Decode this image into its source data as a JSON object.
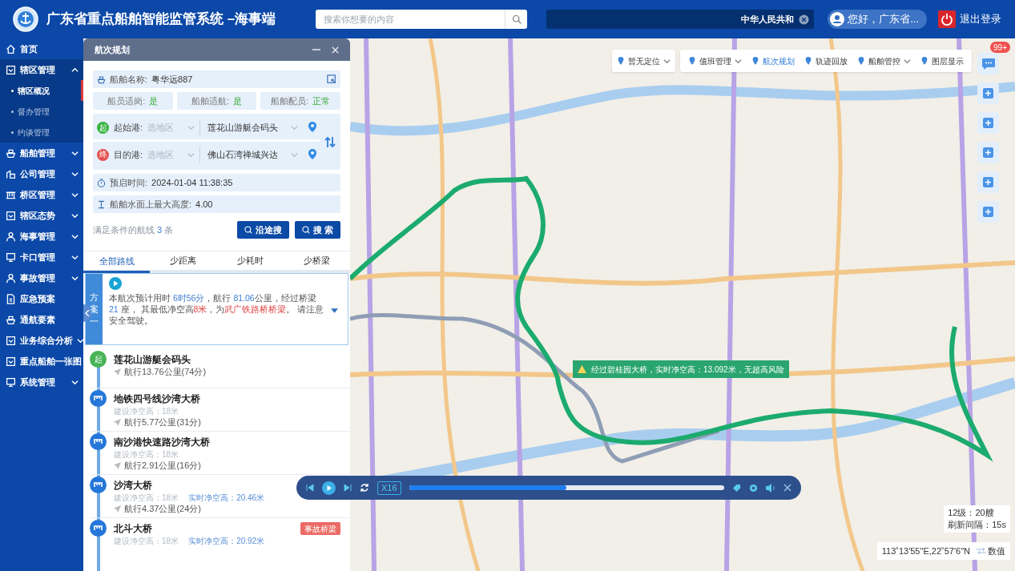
{
  "header": {
    "title": "广东省重点船舶智能监管系统 –海事端",
    "search": {
      "placeholder": "搜索你想要的内容"
    },
    "marquee": "中华人民共和",
    "user": "您好，广东省...",
    "logout": "退出登录"
  },
  "sidebar": {
    "items": [
      {
        "label": "首页",
        "kind": "link"
      },
      {
        "label": "辖区管理",
        "kind": "group",
        "expanded": true,
        "children": [
          {
            "label": "辖区概况",
            "selected": true
          },
          {
            "label": "督办管理",
            "selected": false
          },
          {
            "label": "约谈管理",
            "selected": false
          }
        ]
      },
      {
        "label": "船舶管理",
        "kind": "group",
        "expanded": false
      },
      {
        "label": "公司管理",
        "kind": "group",
        "expanded": false
      },
      {
        "label": "桥区管理",
        "kind": "group",
        "expanded": false
      },
      {
        "label": "辖区态势",
        "kind": "group",
        "expanded": false
      },
      {
        "label": "海事管理",
        "kind": "group",
        "expanded": false
      },
      {
        "label": "卡口管理",
        "kind": "group",
        "expanded": false
      },
      {
        "label": "事故管理",
        "kind": "group",
        "expanded": false
      },
      {
        "label": "应急预案",
        "kind": "link"
      },
      {
        "label": "通航要素",
        "kind": "link"
      },
      {
        "label": "业务综合分析",
        "kind": "group",
        "expanded": false
      },
      {
        "label": "重点船舶一张图",
        "kind": "link"
      },
      {
        "label": "系统管理",
        "kind": "group",
        "expanded": false
      }
    ]
  },
  "panel": {
    "title": "航次规划",
    "ship_name": {
      "label": "船舶名称:",
      "value": "粤华远887"
    },
    "status": [
      {
        "label": "船员适岗:",
        "value": "是"
      },
      {
        "label": "船舶适航:",
        "value": "是"
      },
      {
        "label": "船舶配员:",
        "value": "正常"
      }
    ],
    "ports": [
      {
        "kind": "start",
        "marker": "起",
        "label": "起始港:",
        "region_placeholder": "选地区",
        "port": "莲花山游艇会码头"
      },
      {
        "kind": "end",
        "marker": "终",
        "label": "目的港:",
        "region_placeholder": "选地区",
        "port": "佛山石湾禅城兴达"
      }
    ],
    "departure": {
      "label": "预启时间:",
      "value": "2024-01-04 11:38:35"
    },
    "max_height": {
      "label": "船舶水面上最大高度:",
      "value": "4.00"
    },
    "result": {
      "prefix": "满足条件的航线",
      "count": "3",
      "suffix": "条"
    },
    "buttons": [
      "沿途搜",
      "搜 索"
    ],
    "tabs": [
      {
        "label": "全部路线",
        "selected": true
      },
      {
        "label": "少距离",
        "selected": false
      },
      {
        "label": "少耗时",
        "selected": false
      },
      {
        "label": "少桥梁",
        "selected": false
      }
    ],
    "plan": {
      "label": "方案一",
      "summary": [
        {
          "kind": "plain",
          "text": "本航次预计用时 "
        },
        {
          "kind": "value",
          "text": "6时56分"
        },
        {
          "kind": "plain",
          "text": "，航行 "
        },
        {
          "kind": "value",
          "text": "81.06"
        },
        {
          "kind": "plain",
          "text": "公里，经过桥梁 "
        },
        {
          "kind": "value",
          "text": "21"
        },
        {
          "kind": "plain",
          "text": " 座， 其最低净空高"
        },
        {
          "kind": "danger",
          "text": "8米"
        },
        {
          "kind": "plain",
          "text": "，为"
        },
        {
          "kind": "danger",
          "text": "武广铁路桥桥梁"
        },
        {
          "kind": "plain",
          "text": "。 请注意安全驾驶。"
        }
      ]
    },
    "stops": [
      {
        "kind": "start",
        "marker": "起",
        "name": "莲花山游艇会码头",
        "distance": "航行13.76公里(74分)"
      },
      {
        "kind": "bridge",
        "name": "地铁四号线沙湾大桥",
        "design_clearance": "建设净空高：18米",
        "distance": "航行5.77公里(31分)"
      },
      {
        "kind": "bridge",
        "name": "南沙港快速路沙湾大桥",
        "design_clearance": "建设净空高：18米",
        "distance": "航行2.91公里(16分)"
      },
      {
        "kind": "bridge",
        "name": "沙湾大桥",
        "design_clearance": "建设净空高：18米",
        "realtime_clearance": "实时净空高：20.46米",
        "distance": "航行4.37公里(24分)"
      },
      {
        "kind": "bridge",
        "name": "北斗大桥",
        "design_clearance": "建设净空高：18米",
        "realtime_clearance": "实时净空高：20.92米",
        "badge": "事故桥梁"
      }
    ]
  },
  "map": {
    "toolbar": [
      {
        "label": "暂无定位",
        "kind": "dropdown",
        "selected": false
      },
      {
        "label": "值班管理",
        "kind": "dropdown",
        "selected": false
      },
      {
        "label": "航次规划",
        "kind": "button",
        "selected": true
      },
      {
        "label": "轨迹回放",
        "kind": "button",
        "selected": false
      },
      {
        "label": "船舶管控",
        "kind": "dropdown",
        "selected": false
      },
      {
        "label": "图层显示",
        "kind": "button",
        "selected": false
      }
    ],
    "notifications": "99+",
    "alert": "经过碧桂园大桥，实时净空高：13.092米，无超高风险",
    "player": {
      "speed": "X16",
      "level": 0.5
    },
    "stats": [
      "12级：20艘",
      "刷新间隔：15s"
    ],
    "coordinates": "113˚13'55\"E,22˚57'6\"N",
    "value_toggle": "数值"
  }
}
